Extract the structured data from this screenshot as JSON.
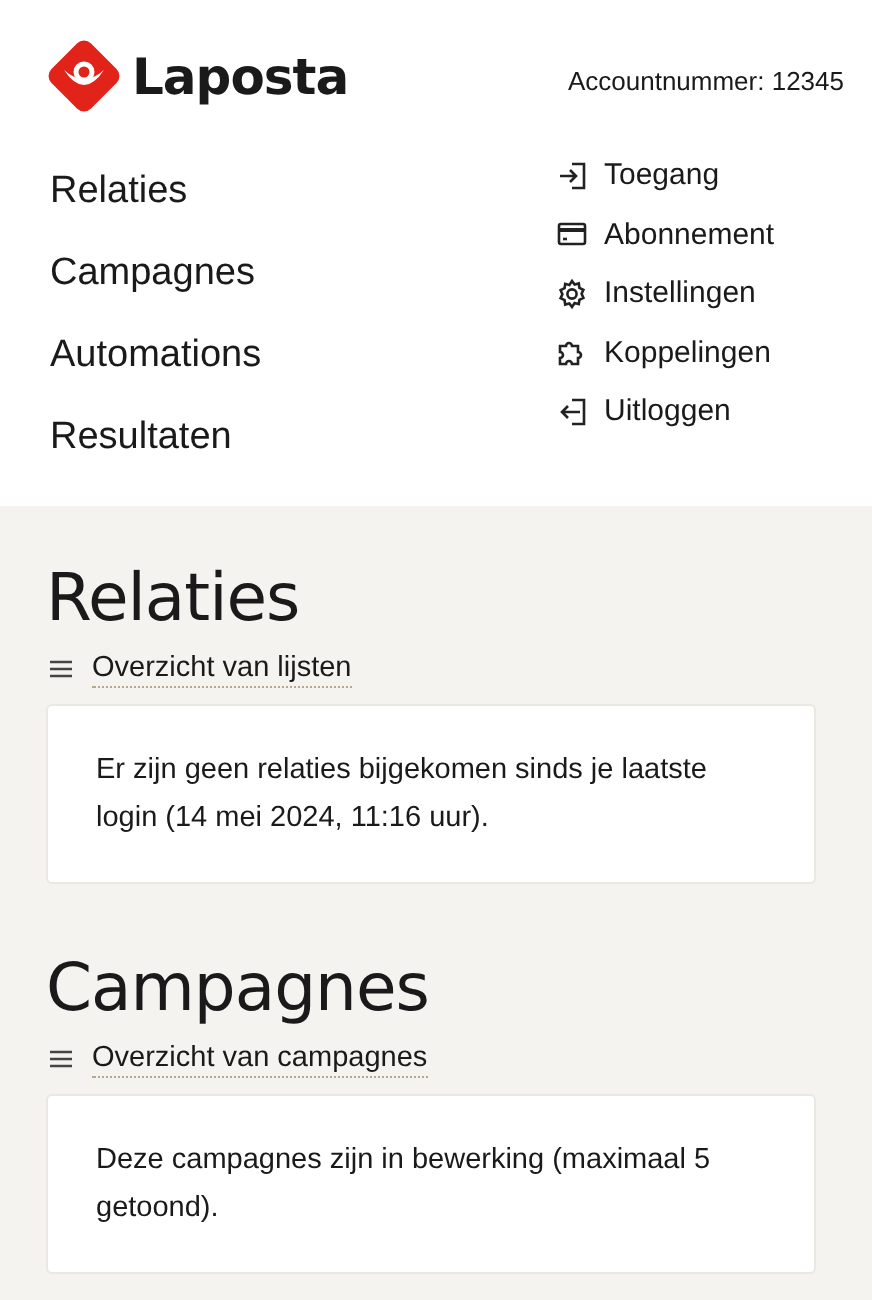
{
  "brand": {
    "name": "Laposta"
  },
  "account": {
    "label": "Accountnummer: 12345"
  },
  "main_nav": [
    {
      "label": "Relaties"
    },
    {
      "label": "Campagnes"
    },
    {
      "label": "Automations"
    },
    {
      "label": "Resultaten"
    }
  ],
  "account_menu": [
    {
      "label": "Toegang",
      "kind": "login"
    },
    {
      "label": "Abonnement",
      "kind": "card"
    },
    {
      "label": "Instellingen",
      "kind": "gear"
    },
    {
      "label": "Koppelingen",
      "kind": "puzzle"
    },
    {
      "label": "Uitloggen",
      "kind": "logout"
    }
  ],
  "sections": [
    {
      "title": "Relaties",
      "link": "Overzicht van lijsten",
      "message": "Er zijn geen relaties bijgekomen sinds je laatste login (14 mei 2024, 11:16 uur)."
    },
    {
      "title": "Campagnes",
      "link": "Overzicht van campagnes",
      "message": "Deze campagnes zijn in bewerking (maximaal 5 getoond)."
    }
  ]
}
